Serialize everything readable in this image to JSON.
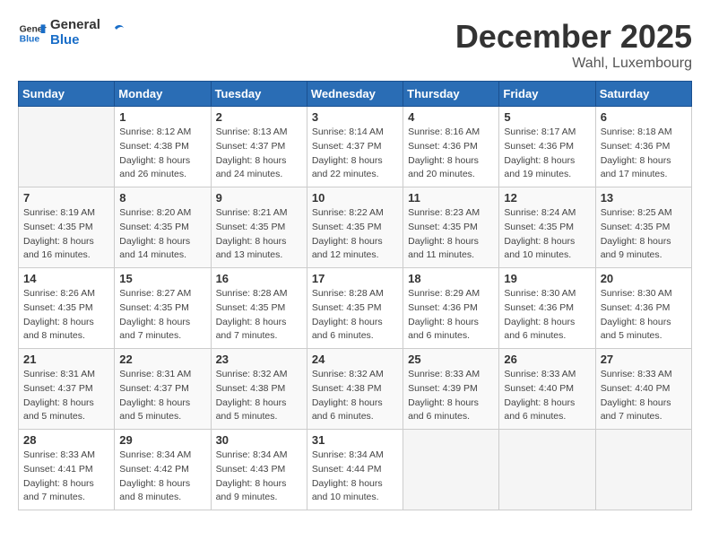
{
  "header": {
    "logo_general": "General",
    "logo_blue": "Blue",
    "month_year": "December 2025",
    "location": "Wahl, Luxembourg"
  },
  "days_of_week": [
    "Sunday",
    "Monday",
    "Tuesday",
    "Wednesday",
    "Thursday",
    "Friday",
    "Saturday"
  ],
  "weeks": [
    [
      {
        "day": "",
        "sunrise": "",
        "sunset": "",
        "daylight": ""
      },
      {
        "day": "1",
        "sunrise": "Sunrise: 8:12 AM",
        "sunset": "Sunset: 4:38 PM",
        "daylight": "Daylight: 8 hours and 26 minutes."
      },
      {
        "day": "2",
        "sunrise": "Sunrise: 8:13 AM",
        "sunset": "Sunset: 4:37 PM",
        "daylight": "Daylight: 8 hours and 24 minutes."
      },
      {
        "day": "3",
        "sunrise": "Sunrise: 8:14 AM",
        "sunset": "Sunset: 4:37 PM",
        "daylight": "Daylight: 8 hours and 22 minutes."
      },
      {
        "day": "4",
        "sunrise": "Sunrise: 8:16 AM",
        "sunset": "Sunset: 4:36 PM",
        "daylight": "Daylight: 8 hours and 20 minutes."
      },
      {
        "day": "5",
        "sunrise": "Sunrise: 8:17 AM",
        "sunset": "Sunset: 4:36 PM",
        "daylight": "Daylight: 8 hours and 19 minutes."
      },
      {
        "day": "6",
        "sunrise": "Sunrise: 8:18 AM",
        "sunset": "Sunset: 4:36 PM",
        "daylight": "Daylight: 8 hours and 17 minutes."
      }
    ],
    [
      {
        "day": "7",
        "sunrise": "Sunrise: 8:19 AM",
        "sunset": "Sunset: 4:35 PM",
        "daylight": "Daylight: 8 hours and 16 minutes."
      },
      {
        "day": "8",
        "sunrise": "Sunrise: 8:20 AM",
        "sunset": "Sunset: 4:35 PM",
        "daylight": "Daylight: 8 hours and 14 minutes."
      },
      {
        "day": "9",
        "sunrise": "Sunrise: 8:21 AM",
        "sunset": "Sunset: 4:35 PM",
        "daylight": "Daylight: 8 hours and 13 minutes."
      },
      {
        "day": "10",
        "sunrise": "Sunrise: 8:22 AM",
        "sunset": "Sunset: 4:35 PM",
        "daylight": "Daylight: 8 hours and 12 minutes."
      },
      {
        "day": "11",
        "sunrise": "Sunrise: 8:23 AM",
        "sunset": "Sunset: 4:35 PM",
        "daylight": "Daylight: 8 hours and 11 minutes."
      },
      {
        "day": "12",
        "sunrise": "Sunrise: 8:24 AM",
        "sunset": "Sunset: 4:35 PM",
        "daylight": "Daylight: 8 hours and 10 minutes."
      },
      {
        "day": "13",
        "sunrise": "Sunrise: 8:25 AM",
        "sunset": "Sunset: 4:35 PM",
        "daylight": "Daylight: 8 hours and 9 minutes."
      }
    ],
    [
      {
        "day": "14",
        "sunrise": "Sunrise: 8:26 AM",
        "sunset": "Sunset: 4:35 PM",
        "daylight": "Daylight: 8 hours and 8 minutes."
      },
      {
        "day": "15",
        "sunrise": "Sunrise: 8:27 AM",
        "sunset": "Sunset: 4:35 PM",
        "daylight": "Daylight: 8 hours and 7 minutes."
      },
      {
        "day": "16",
        "sunrise": "Sunrise: 8:28 AM",
        "sunset": "Sunset: 4:35 PM",
        "daylight": "Daylight: 8 hours and 7 minutes."
      },
      {
        "day": "17",
        "sunrise": "Sunrise: 8:28 AM",
        "sunset": "Sunset: 4:35 PM",
        "daylight": "Daylight: 8 hours and 6 minutes."
      },
      {
        "day": "18",
        "sunrise": "Sunrise: 8:29 AM",
        "sunset": "Sunset: 4:36 PM",
        "daylight": "Daylight: 8 hours and 6 minutes."
      },
      {
        "day": "19",
        "sunrise": "Sunrise: 8:30 AM",
        "sunset": "Sunset: 4:36 PM",
        "daylight": "Daylight: 8 hours and 6 minutes."
      },
      {
        "day": "20",
        "sunrise": "Sunrise: 8:30 AM",
        "sunset": "Sunset: 4:36 PM",
        "daylight": "Daylight: 8 hours and 5 minutes."
      }
    ],
    [
      {
        "day": "21",
        "sunrise": "Sunrise: 8:31 AM",
        "sunset": "Sunset: 4:37 PM",
        "daylight": "Daylight: 8 hours and 5 minutes."
      },
      {
        "day": "22",
        "sunrise": "Sunrise: 8:31 AM",
        "sunset": "Sunset: 4:37 PM",
        "daylight": "Daylight: 8 hours and 5 minutes."
      },
      {
        "day": "23",
        "sunrise": "Sunrise: 8:32 AM",
        "sunset": "Sunset: 4:38 PM",
        "daylight": "Daylight: 8 hours and 5 minutes."
      },
      {
        "day": "24",
        "sunrise": "Sunrise: 8:32 AM",
        "sunset": "Sunset: 4:38 PM",
        "daylight": "Daylight: 8 hours and 6 minutes."
      },
      {
        "day": "25",
        "sunrise": "Sunrise: 8:33 AM",
        "sunset": "Sunset: 4:39 PM",
        "daylight": "Daylight: 8 hours and 6 minutes."
      },
      {
        "day": "26",
        "sunrise": "Sunrise: 8:33 AM",
        "sunset": "Sunset: 4:40 PM",
        "daylight": "Daylight: 8 hours and 6 minutes."
      },
      {
        "day": "27",
        "sunrise": "Sunrise: 8:33 AM",
        "sunset": "Sunset: 4:40 PM",
        "daylight": "Daylight: 8 hours and 7 minutes."
      }
    ],
    [
      {
        "day": "28",
        "sunrise": "Sunrise: 8:33 AM",
        "sunset": "Sunset: 4:41 PM",
        "daylight": "Daylight: 8 hours and 7 minutes."
      },
      {
        "day": "29",
        "sunrise": "Sunrise: 8:34 AM",
        "sunset": "Sunset: 4:42 PM",
        "daylight": "Daylight: 8 hours and 8 minutes."
      },
      {
        "day": "30",
        "sunrise": "Sunrise: 8:34 AM",
        "sunset": "Sunset: 4:43 PM",
        "daylight": "Daylight: 8 hours and 9 minutes."
      },
      {
        "day": "31",
        "sunrise": "Sunrise: 8:34 AM",
        "sunset": "Sunset: 4:44 PM",
        "daylight": "Daylight: 8 hours and 10 minutes."
      },
      {
        "day": "",
        "sunrise": "",
        "sunset": "",
        "daylight": ""
      },
      {
        "day": "",
        "sunrise": "",
        "sunset": "",
        "daylight": ""
      },
      {
        "day": "",
        "sunrise": "",
        "sunset": "",
        "daylight": ""
      }
    ]
  ]
}
